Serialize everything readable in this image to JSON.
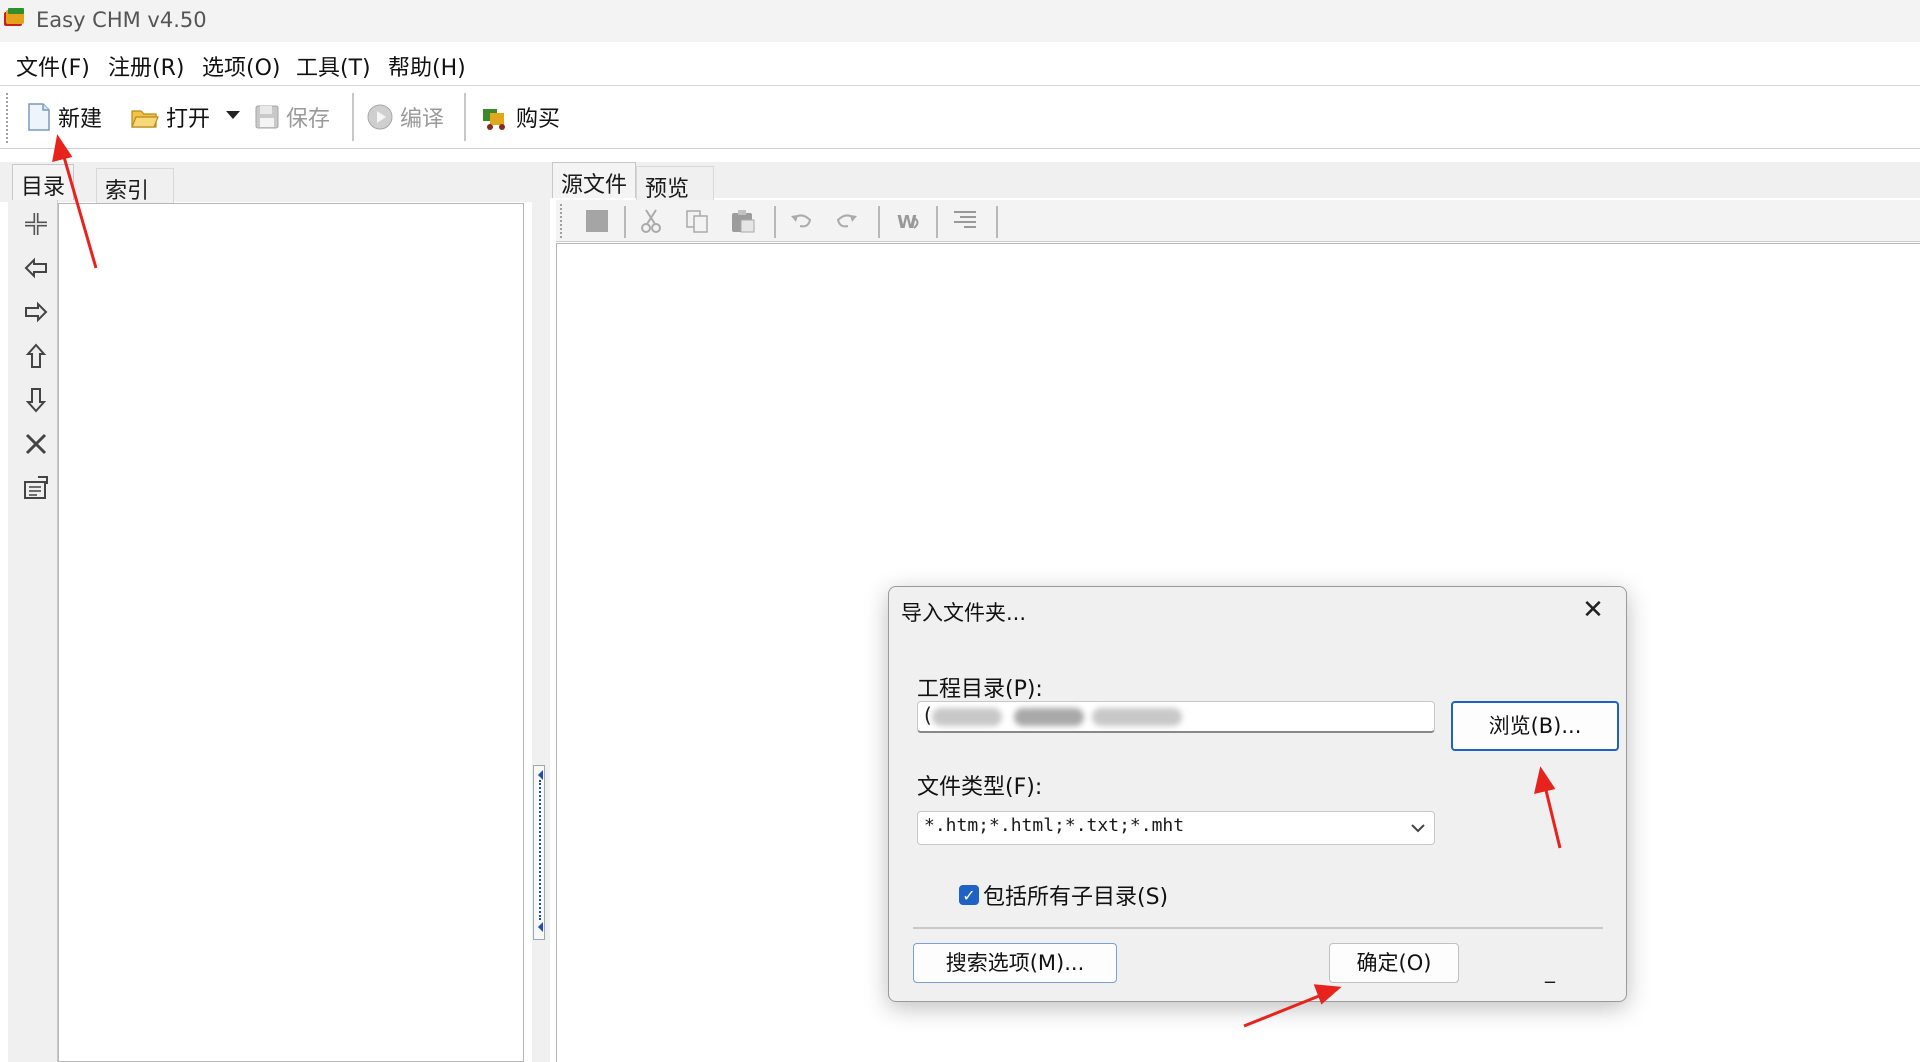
{
  "window": {
    "title": "Easy CHM v4.50"
  },
  "menu": {
    "items": [
      {
        "label": "文件(F)"
      },
      {
        "label": "注册(R)"
      },
      {
        "label": "选项(O)"
      },
      {
        "label": "工具(T)"
      },
      {
        "label": "帮助(H)"
      }
    ]
  },
  "toolbar": {
    "new_label": "新建",
    "open_label": "打开",
    "save_label": "保存",
    "compile_label": "编译",
    "buy_label": "购买"
  },
  "left_tabs": {
    "toc": "目录",
    "index": "索引"
  },
  "right_tabs": {
    "source": "源文件",
    "preview": "预览"
  },
  "dialog": {
    "title": "导入文件夹...",
    "close_glyph": "✕",
    "project_dir_label": "工程目录(P):",
    "project_dir_value_prefix": "(",
    "browse_label": "浏览(B)...",
    "file_type_label": "文件类型(F):",
    "file_type_value": "*.htm;*.html;*.txt;*.mht",
    "include_subdirs_label": "包括所有子目录(S)",
    "include_subdirs_checked": true,
    "search_options_label": "搜索选项(M)...",
    "ok_label": "确定(O)",
    "trailing_mark": "_"
  },
  "colors": {
    "accent": "#1e62c5",
    "annotation_arrow": "#e8231e"
  },
  "icons": {
    "app": "easy-chm-book-icon",
    "new": "new-document-icon",
    "open": "open-folder-icon",
    "save": "floppy-disk-icon",
    "compile": "play-compile-icon",
    "buy": "shopping-cart-icon"
  }
}
